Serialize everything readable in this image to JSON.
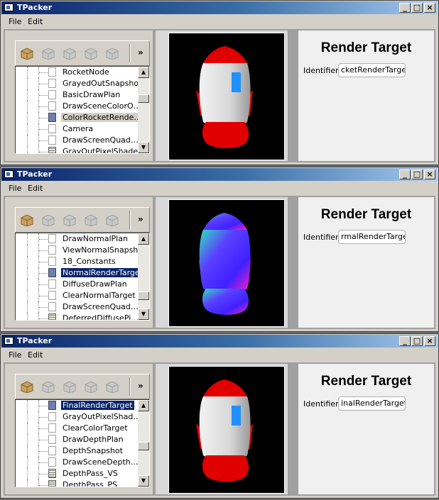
{
  "windows": [
    {
      "title": "TPacker",
      "menu": [
        "File",
        "Edit"
      ],
      "tree_items": [
        {
          "label": "RocketNode",
          "icon": "file-icon",
          "state": ""
        },
        {
          "label": "GrayedOutSnapshot",
          "icon": "file-icon",
          "state": ""
        },
        {
          "label": "BasicDrawPlan",
          "icon": "file-icon",
          "state": ""
        },
        {
          "label": "DrawSceneColorO…",
          "icon": "file-icon",
          "state": ""
        },
        {
          "label": "ColorRocketRende…",
          "icon": "render-target-icon",
          "state": "hl"
        },
        {
          "label": "Camera",
          "icon": "file-icon",
          "state": ""
        },
        {
          "label": "DrawScreenQuad…",
          "icon": "file-icon",
          "state": ""
        },
        {
          "label": "GrayOutPixelShader",
          "icon": "shader-icon",
          "state": ""
        }
      ],
      "scroll_position": 0.3,
      "panel_title": "Render Target",
      "identifier_label": "Identifier",
      "identifier_value": "cketRenderTarget",
      "render_style": "color"
    },
    {
      "title": "TPacker",
      "menu": [
        "File",
        "Edit"
      ],
      "tree_items": [
        {
          "label": "DrawNormalPlan",
          "icon": "file-icon",
          "state": ""
        },
        {
          "label": "ViewNormalSnapshot",
          "icon": "file-icon",
          "state": ""
        },
        {
          "label": "18_Constants",
          "icon": "file-icon",
          "state": ""
        },
        {
          "label": "NormalRenderTarget",
          "icon": "render-target-icon",
          "state": "sel"
        },
        {
          "label": "DiffuseDrawPlan",
          "icon": "file-icon",
          "state": ""
        },
        {
          "label": "ClearNormalTarget",
          "icon": "file-icon",
          "state": ""
        },
        {
          "label": "DrawScreenQuad…",
          "icon": "file-icon",
          "state": ""
        },
        {
          "label": "DeferredDiffusePi…",
          "icon": "shader-icon",
          "state": ""
        }
      ],
      "scroll_position": 0.85,
      "panel_title": "Render Target",
      "identifier_label": "Identifier",
      "identifier_value": "rmalRenderTarget",
      "render_style": "normal"
    },
    {
      "title": "TPacker",
      "menu": [
        "File",
        "Edit"
      ],
      "tree_items": [
        {
          "label": "FinalRenderTarget",
          "icon": "render-target-icon",
          "state": "sel"
        },
        {
          "label": "GrayOutPixelShad…",
          "icon": "file-icon",
          "state": ""
        },
        {
          "label": "ClearColorTarget",
          "icon": "file-icon",
          "state": ""
        },
        {
          "label": "DrawDepthPlan",
          "icon": "file-icon",
          "state": ""
        },
        {
          "label": "DepthSnapshot",
          "icon": "file-icon",
          "state": ""
        },
        {
          "label": "DrawSceneDepth…",
          "icon": "file-icon",
          "state": ""
        },
        {
          "label": "DepthPass_VS",
          "icon": "shader-icon",
          "state": ""
        },
        {
          "label": "DepthPass_PS",
          "icon": "shader-icon",
          "state": ""
        }
      ],
      "scroll_position": 0.55,
      "panel_title": "Render Target",
      "identifier_label": "Identifier",
      "identifier_value": "inalRenderTarget",
      "render_style": "gray"
    }
  ],
  "window_buttons": {
    "minimize": "_",
    "maximize": "□",
    "close": "×"
  },
  "toolbar_more": "»"
}
